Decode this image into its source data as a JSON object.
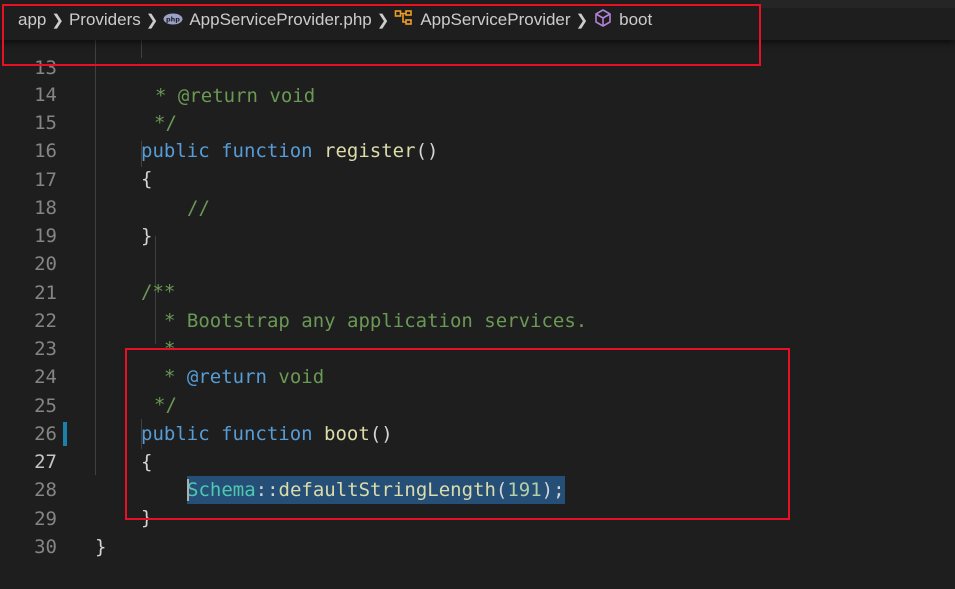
{
  "breadcrumb": {
    "items": [
      {
        "label": "app",
        "icon": ""
      },
      {
        "label": "Providers",
        "icon": ""
      },
      {
        "label": "AppServiceProvider.php",
        "icon": "php-file-icon"
      },
      {
        "label": "AppServiceProvider",
        "icon": "class-icon"
      },
      {
        "label": "boot",
        "icon": "method-cube-icon"
      }
    ]
  },
  "editor": {
    "active_line": "27",
    "lines": {
      "l13": {
        "num": "13",
        "text": "* @return void"
      },
      "l14": {
        "num": "14",
        "text": "*/"
      },
      "l15": {
        "num": "15",
        "kw": "public function",
        "fn": "register",
        "rest": "()"
      },
      "l16": {
        "num": "16",
        "text": "{"
      },
      "l17": {
        "num": "17",
        "text": "//"
      },
      "l18": {
        "num": "18",
        "text": "}"
      },
      "l19": {
        "num": "19"
      },
      "l20": {
        "num": "20",
        "text": "/**"
      },
      "l21": {
        "num": "21",
        "text": "* Bootstrap any application services."
      },
      "l22": {
        "num": "22",
        "text": "*"
      },
      "l23": {
        "num": "23",
        "star": "* ",
        "tag": "@return",
        "type": "void"
      },
      "l24": {
        "num": "24",
        "text": "*/"
      },
      "l25": {
        "num": "25",
        "kw": "public function",
        "fn": "boot",
        "rest": "()"
      },
      "l26": {
        "num": "26",
        "text": "{"
      },
      "l27": {
        "num": "27",
        "cls_first": "S",
        "cls_rest": "chema",
        "op": "::",
        "fn": "defaultStringLength",
        "open": "(",
        "num_arg": "191",
        "close": ");"
      },
      "l28": {
        "num": "28",
        "text": "}"
      },
      "l29": {
        "num": "29",
        "text": "}"
      },
      "l30": {
        "num": "30"
      }
    }
  },
  "colors": {
    "highlight_box": "#e81123",
    "keyword": "#569cd6",
    "function": "#dcdcaa",
    "comment": "#6a9955",
    "class": "#4ec9b0",
    "number": "#b5cea8",
    "selection": "#264f78",
    "background": "#1e1e1e"
  }
}
